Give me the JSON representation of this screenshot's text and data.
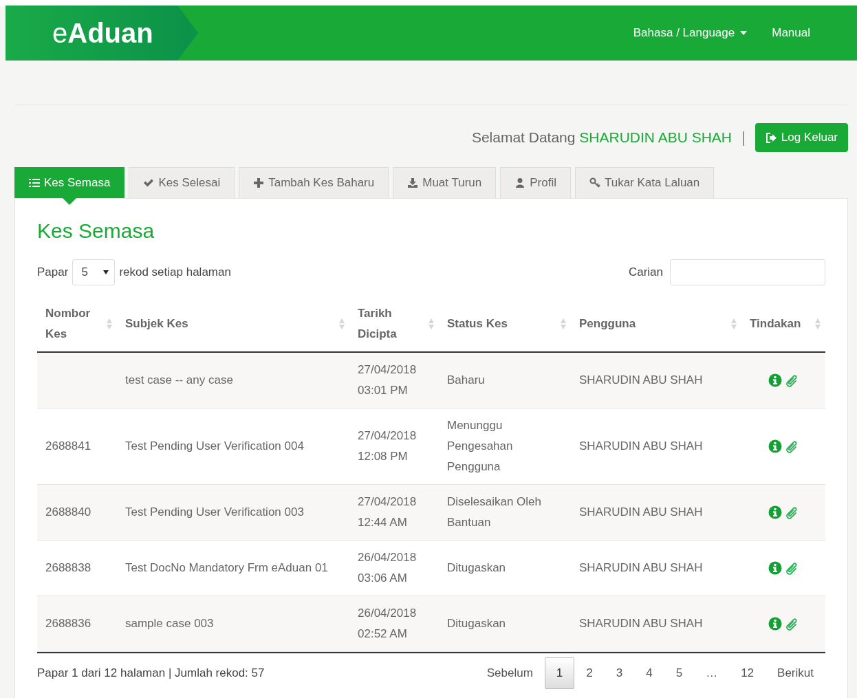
{
  "header": {
    "logo": "e**Aduan**",
    "nav": [
      {
        "label": "Bahasa / Language",
        "dropdown": true
      },
      {
        "label": "Manual",
        "dropdown": false
      }
    ]
  },
  "welcome": {
    "greeting": "Selamat Datang",
    "user": "SHARUDIN ABU SHAH",
    "separator": "|",
    "logout": "Log Keluar"
  },
  "tabs": [
    {
      "label": "Kes Semasa",
      "selected": true
    },
    {
      "label": "Kes Selesai",
      "selected": false
    },
    {
      "label": "Tambah Kes Baharu",
      "selected": false
    },
    {
      "label": "Muat Turun",
      "selected": false
    },
    {
      "label": "Profil",
      "selected": false
    },
    {
      "label": "Tukar Kata Laluan",
      "selected": false
    }
  ],
  "panel_title": "Kes Semasa",
  "length_control": {
    "before": "Papar",
    "value": "5",
    "after": "rekod setiap halaman"
  },
  "search": {
    "label": "Carian"
  },
  "table": {
    "columns": [
      "Nombor Kes",
      "Subjek Kes",
      "Tarikh Dicipta",
      "Status Kes",
      "Pengguna",
      "Tindakan"
    ],
    "rows": [
      {
        "number": "",
        "subject": "test case -- any case",
        "date": "27/04/2018 03:01 PM",
        "status": "Baharu",
        "user": "SHARUDIN ABU SHAH"
      },
      {
        "number": "2688841",
        "subject": "Test Pending User Verification 004",
        "date": "27/04/2018 12:08 PM",
        "status": "Menunggu Pengesahan Pengguna",
        "user": "SHARUDIN ABU SHAH"
      },
      {
        "number": "2688840",
        "subject": "Test Pending User Verification 003",
        "date": "27/04/2018 12:44 AM",
        "status": "Diselesaikan Oleh Bantuan",
        "user": "SHARUDIN ABU SHAH"
      },
      {
        "number": "2688838",
        "subject": "Test DocNo Mandatory Frm eAduan 01",
        "date": "26/04/2018 03:06 AM",
        "status": "Ditugaskan",
        "user": "SHARUDIN ABU SHAH"
      },
      {
        "number": "2688836",
        "subject": "sample case 003",
        "date": "26/04/2018 02:52 AM",
        "status": "Ditugaskan",
        "user": "SHARUDIN ABU SHAH"
      }
    ]
  },
  "footer": {
    "info": "Papar 1 dari 12 halaman | Jumlah rekod: 57",
    "previous": "Sebelum",
    "next": "Berikut",
    "pages": [
      {
        "label": "1",
        "selected": true
      },
      {
        "label": "2",
        "selected": false
      },
      {
        "label": "3",
        "selected": false
      },
      {
        "label": "4",
        "selected": false
      },
      {
        "label": "5",
        "selected": false
      },
      {
        "label": "…",
        "selected": false
      },
      {
        "label": "12",
        "selected": false
      }
    ]
  }
}
